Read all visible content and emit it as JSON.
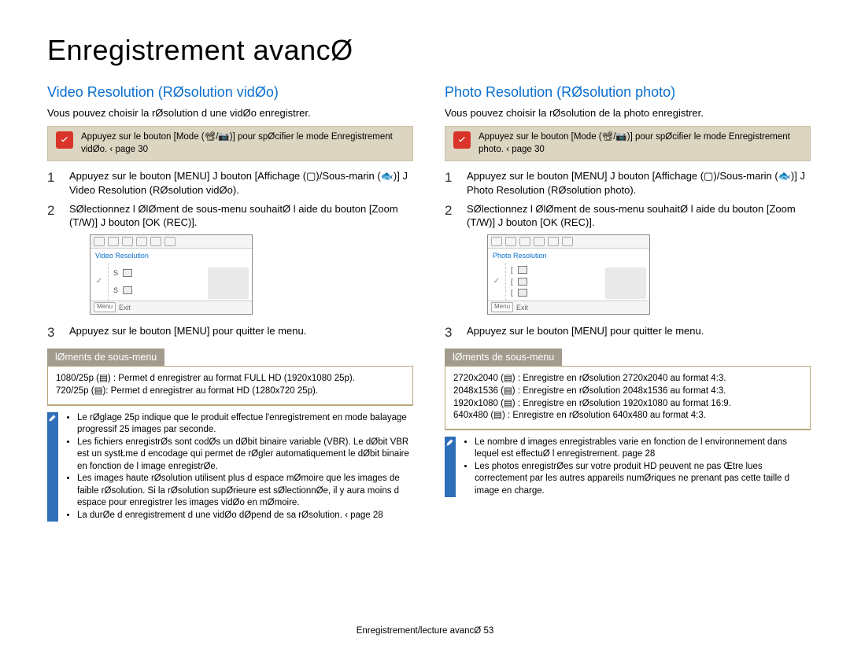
{
  "page_title": "Enregistrement avancØ",
  "footer": "Enregistrement/lecture avancØ 53",
  "left": {
    "heading": "Video Resolution (RØsolution vidØo)",
    "intro": "Vous pouvez choisir la rØsolution d une vidØo   enregistrer.",
    "tip": "Appuyez sur le bouton [Mode (📽/📷)] pour spØcifier le mode Enregistrement vidØo. ‹ page 30",
    "steps": {
      "s1": "Appuyez sur le bouton [MENU] J bouton [Affichage (▢)/Sous-marin (🐟)] J Video Resolution (RØsolution vidØo).",
      "s2": "SØlectionnez l ØlØment de sous-menu souhaitØ   l aide du bouton [Zoom (T/W)]  J bouton [OK (REC)].",
      "s3": "Appuyez sur le bouton [MENU] pour quitter le menu."
    },
    "camera": {
      "title": "Video Resolution",
      "items": [
        "S",
        "S"
      ],
      "exit": "Exit",
      "menu": "Menu"
    },
    "sub_header": "lØments de sous-menu",
    "sub_items": "1080/25p (▤)   : Permet d enregistrer au format FULL HD (1920x1080 25p).\n720/25p (▤): Permet d enregistrer au format HD (1280x720 25p).",
    "note_items": [
      "Le rØglage 25p indique que le produit effectue l'enregistrement en mode balayage progressif   25 images par seconde.",
      "Les fichiers enregistrØs sont codØs   un dØbit binaire variable (VBR). Le dØbit VBR est un systŁme d encodage qui permet de rØgler automatiquement le dØbit binaire en fonction de l image enregistrØe.",
      "Les images   haute rØsolution utilisent plus d espace mØmoire que les images de faible rØsolution. Si la rØsolution supØrieure est sØlectionnØe, il y aura moins d espace pour enregistrer les images vidØo en mØmoire.",
      "La durØe d enregistrement d une vidØo dØpend de sa rØsolution. ‹ page 28"
    ]
  },
  "right": {
    "heading": "Photo Resolution (RØsolution photo)",
    "intro": "Vous pouvez choisir la rØsolution de la photo   enregistrer.",
    "tip": "Appuyez sur le bouton [Mode (📽/📷)] pour spØcifier le mode Enregistrement photo. ‹ page 30",
    "steps": {
      "s1": "Appuyez sur le bouton [MENU] J bouton [Affichage (▢)/Sous-marin (🐟)] J Photo Resolution (RØsolution photo).",
      "s2": "SØlectionnez l ØlØment de sous-menu souhaitØ   l aide du bouton [Zoom (T/W)]  J bouton [OK (REC)].",
      "s3": "Appuyez sur le bouton [MENU] pour quitter le menu."
    },
    "camera": {
      "title": "Photo Resolution",
      "items": [
        "[",
        "[",
        "["
      ],
      "exit": "Exit",
      "menu": "Menu"
    },
    "sub_header": "lØments de sous-menu",
    "sub_items": "2720x2040 (▤) : Enregistre en rØsolution 2720x2040 au format 4:3.\n2048x1536 (▤) : Enregistre en rØsolution 2048x1536 au format 4:3.\n1920x1080 (▤) : Enregistre en rØsolution 1920x1080 au format 16:9.\n640x480 (▤) : Enregistre en rØsolution 640x480 au format 4:3.",
    "note_items": [
      "Le nombre d images enregistrables varie en fonction de l environnement dans lequel est effectuØ l enregistrement. page 28",
      "Les photos enregistrØes sur votre produit HD peuvent ne pas Œtre lues correctement par les autres appareils numØriques ne prenant pas cette taille d image en charge."
    ]
  }
}
